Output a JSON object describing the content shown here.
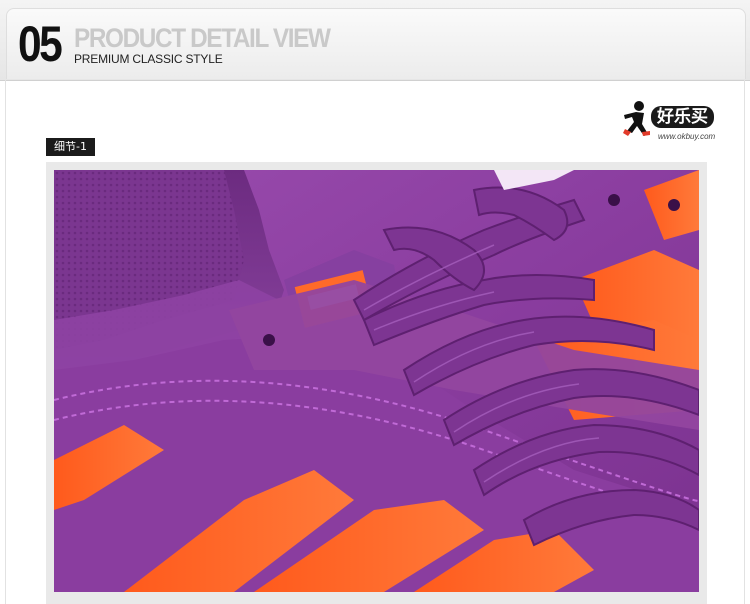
{
  "header": {
    "number": "05",
    "title": "PRODUCT DETAIL VIEW",
    "subtitle": "PREMIUM CLASSIC STYLE"
  },
  "logo": {
    "name": "好乐买",
    "url": "www.okbuy.com"
  },
  "detail": {
    "label": "细节-1",
    "image": "purple-suede-sneaker-closeup"
  },
  "colors": {
    "suede_purple": "#8a3f9e",
    "stripe_orange": "#ff6a2a",
    "lace_purple": "#7d3592",
    "tag_bg": "#1b1b1b"
  }
}
